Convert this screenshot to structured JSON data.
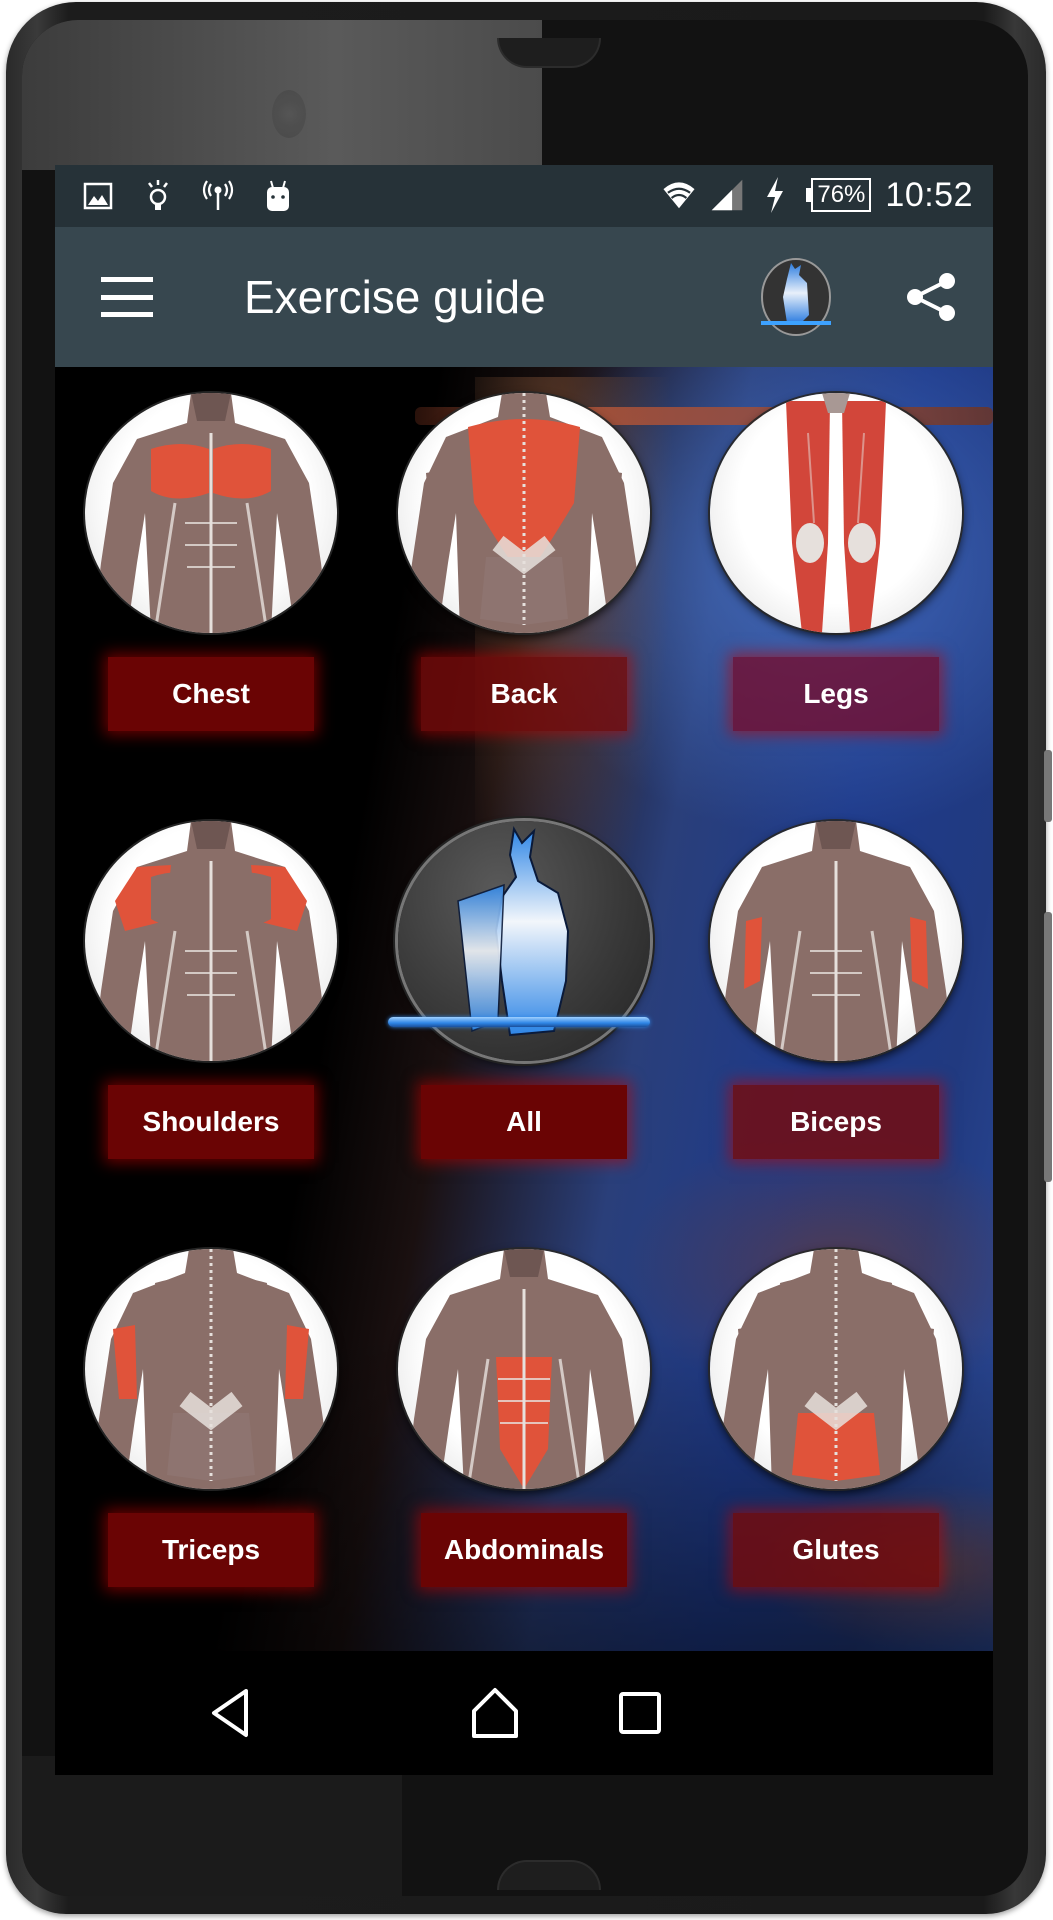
{
  "status_bar": {
    "left_icons": [
      "image-icon",
      "lightbulb-icon",
      "broadcast-icon",
      "android-icon"
    ],
    "right_icons": [
      "wifi-icon",
      "signal-icon",
      "charging-icon"
    ],
    "battery_percent": "76%",
    "time": "10:52"
  },
  "app_bar": {
    "menu_icon": "hamburger-menu-icon",
    "title": "Exercise guide",
    "logo_icon": "bodybuilder-logo-icon",
    "share_icon": "share-icon"
  },
  "muscle_groups": [
    {
      "label": "Chest",
      "highlight": "pectorals",
      "view": "front",
      "accent": "#e0533a"
    },
    {
      "label": "Back",
      "highlight": "back",
      "view": "rear",
      "accent": "#e0533a"
    },
    {
      "label": "Legs",
      "highlight": "quadriceps",
      "view": "legs",
      "accent": "#d2463a"
    },
    {
      "label": "Shoulders",
      "highlight": "deltoids",
      "view": "front",
      "accent": "#e0533a"
    },
    {
      "label": "All",
      "highlight": "all",
      "view": "logo",
      "accent": "#3a8de0"
    },
    {
      "label": "Biceps",
      "highlight": "biceps",
      "view": "front",
      "accent": "#e0533a"
    },
    {
      "label": "Triceps",
      "highlight": "triceps",
      "view": "rear",
      "accent": "#e0533a"
    },
    {
      "label": "Abdominals",
      "highlight": "abs",
      "view": "front",
      "accent": "#e0533a"
    },
    {
      "label": "Glutes",
      "highlight": "glutes",
      "view": "rear",
      "accent": "#e0533a"
    }
  ],
  "nav_bar": {
    "back": "back-icon",
    "home": "home-icon",
    "recents": "recents-icon"
  },
  "colors": {
    "status_bar": "#263238",
    "app_bar": "#37474f",
    "button": "#6a0404",
    "button_glow": "#be0000"
  }
}
